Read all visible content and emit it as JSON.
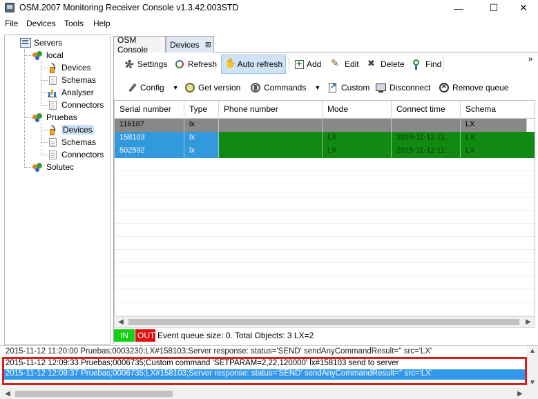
{
  "window": {
    "title": "OSM.2007 Monitoring Receiver Console v1.3.42.003STD",
    "controls": {
      "minimize": "—",
      "maximize": "☐",
      "close": "✕"
    }
  },
  "menu": [
    "File",
    "Devices",
    "Tools",
    "Help"
  ],
  "tree": {
    "root": "Servers",
    "servers": [
      {
        "label": "local",
        "children": [
          "Devices",
          "Schemas",
          "Analyser",
          "Connectors"
        ]
      },
      {
        "label": "Pruebas",
        "children": [
          "Devices",
          "Schemas",
          "Connectors"
        ],
        "selected_child": "Devices"
      },
      {
        "label": "Solutec",
        "children": []
      }
    ]
  },
  "tabs": [
    {
      "label": "OSM Console",
      "active": false
    },
    {
      "label": "Devices",
      "active": true,
      "close": "⊠"
    }
  ],
  "toolbar1": {
    "settings": "Settings",
    "refresh": "Refresh",
    "auto_refresh": "Auto refresh",
    "add": "Add",
    "edit": "Edit",
    "delete": "Delete",
    "find": "Find",
    "overflow": "»"
  },
  "toolbar2": {
    "config": "Config",
    "get_version": "Get version",
    "commands": "Commands",
    "custom": "Custom",
    "disconnect": "Disconnect",
    "remove_queue": "Remove queue",
    "dropdown": "▼"
  },
  "grid": {
    "columns": [
      "Serial number",
      "Type",
      "Phone number",
      "Mode",
      "Connect time",
      "Schema"
    ],
    "rows": [
      {
        "serial": "116187",
        "type": "lx",
        "phone": "",
        "mode": "",
        "connect_time": "",
        "schema": "LX",
        "state": "gray"
      },
      {
        "serial": "158103",
        "type": "lx",
        "phone": "",
        "mode": "LX",
        "connect_time": "2015-11-12 11:...",
        "schema": "LX",
        "state": "selected"
      },
      {
        "serial": "502592",
        "type": "lx",
        "phone": "",
        "mode": "LX",
        "connect_time": "2015-11-12 11:...",
        "schema": "LX",
        "state": "selected"
      }
    ]
  },
  "status": {
    "in": "IN",
    "out": "OUT",
    "text": "Event queue size: 0.  Total Objects: 3   LX=2"
  },
  "log": {
    "lines": [
      "2015-11-12 11:20:00  Pruebas;0003230;LX#158103;Server response: status='SEND' sendAnyCommandResult='' src='LX'",
      "2015-11-12 12:09:33  Pruebas;0006735;Custom command 'SETPARAM=2,22,120000' lx#158103 send to server",
      "2015-11-12 12:09:37  Pruebas;0006735;LX#158103;Server response: status='SEND' sendAnyCommandResult='' src='LX'"
    ]
  },
  "colors": {
    "row_gray": "#888888",
    "row_green": "#108a10",
    "row_blue": "#3399dd",
    "status_in": "#14d014",
    "status_out": "#e01010",
    "highlight_box": "#e11a1a"
  }
}
